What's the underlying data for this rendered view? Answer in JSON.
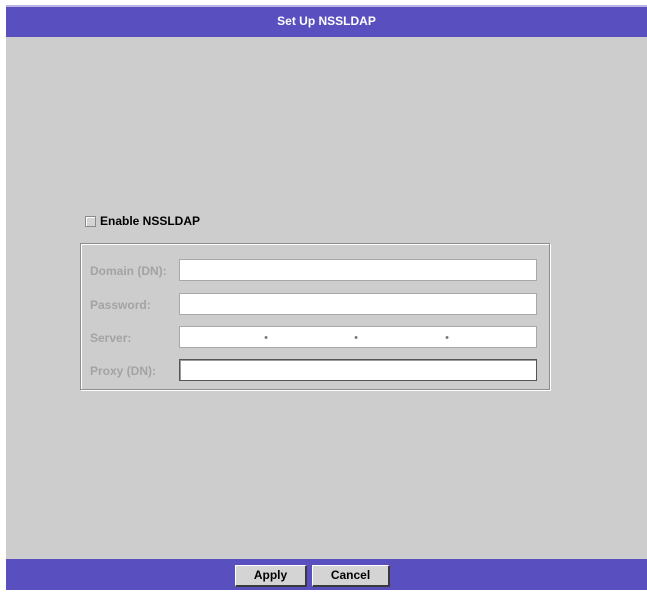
{
  "window": {
    "title": "Set Up NSSLDAP"
  },
  "enable": {
    "label": "Enable NSSLDAP",
    "checked": false
  },
  "fields": {
    "domain": {
      "label": "Domain (DN):",
      "value": ""
    },
    "password": {
      "label": "Password:",
      "value": ""
    },
    "server": {
      "label": "Server:",
      "octets": [
        "",
        "",
        "",
        ""
      ],
      "separator": "•"
    },
    "proxy": {
      "label": "Proxy (DN):",
      "value": ""
    }
  },
  "buttons": {
    "apply": "Apply",
    "cancel": "Cancel"
  },
  "colors": {
    "title_bar": "#5a4fbf",
    "background": "#cdcdcd",
    "disabled_label": "#a3a3a3"
  }
}
